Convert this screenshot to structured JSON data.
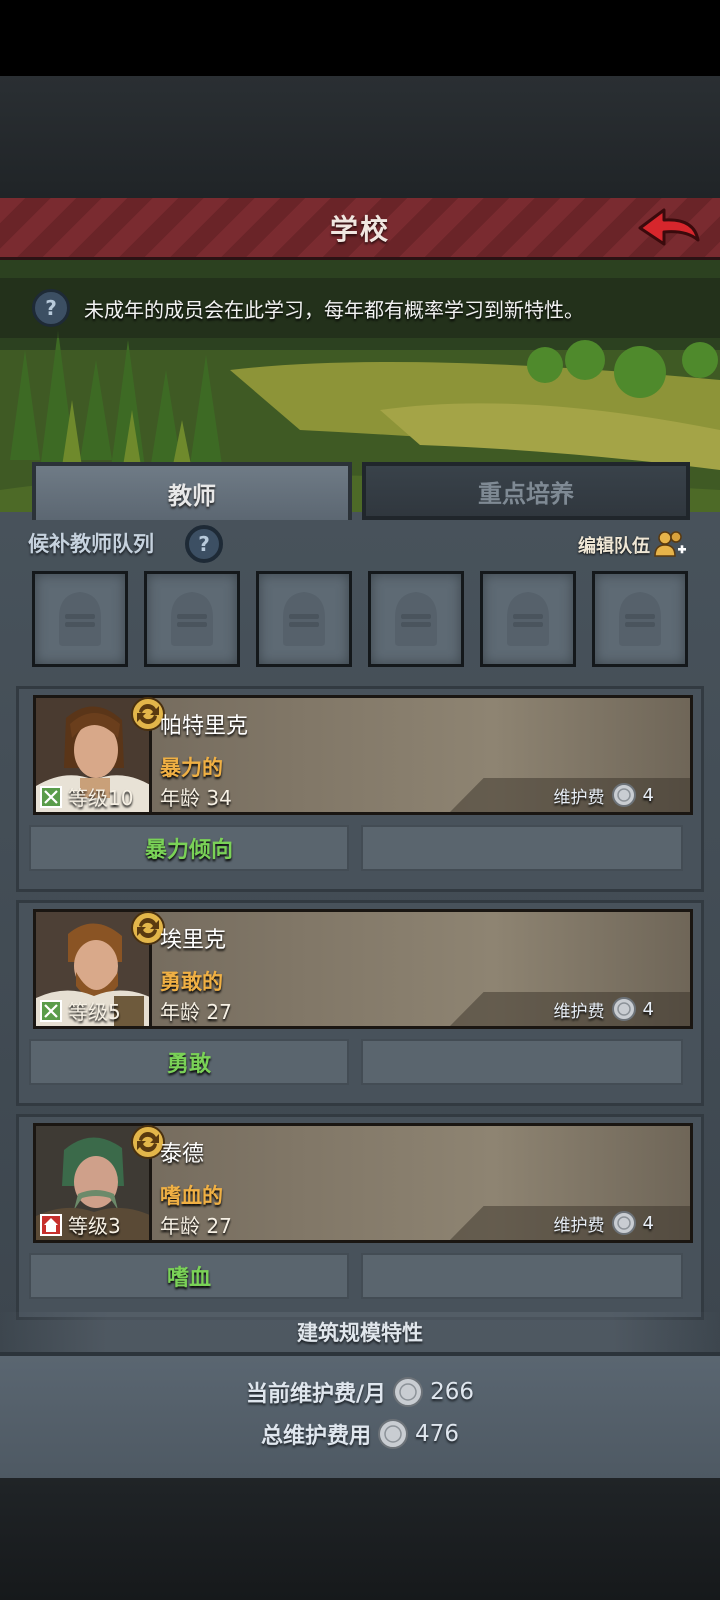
{
  "title": "学校",
  "info_text": "未成年的成员会在此学习，每年都有概率学习到新特性。",
  "help_symbol": "?",
  "tabs": [
    {
      "label": "教师",
      "active": true
    },
    {
      "label": "重点培养",
      "active": false
    }
  ],
  "queue": {
    "label": "候补教师队列",
    "edit_label": "编辑队伍",
    "slot_count": 6
  },
  "teachers": [
    {
      "name": "帕特里克",
      "trait_adj": "暴力的",
      "level_label": "等级10",
      "age_label": "年龄 34",
      "upkeep_label": "维护费",
      "upkeep_value": "4",
      "trait": "暴力倾向",
      "icon": "crossed-swords-icon"
    },
    {
      "name": "埃里克",
      "trait_adj": "勇敢的",
      "level_label": "等级5",
      "age_label": "年龄 27",
      "upkeep_label": "维护费",
      "upkeep_value": "4",
      "trait": "勇敢",
      "icon": "crossed-swords-icon"
    },
    {
      "name": "泰德",
      "trait_adj": "嗜血的",
      "level_label": "等级3",
      "age_label": "年龄 27",
      "upkeep_label": "维护费",
      "upkeep_value": "4",
      "trait": "嗜血",
      "icon": "house-icon"
    }
  ],
  "building_label": "建筑规模特性",
  "costs": {
    "monthly_label": "当前维护费/月",
    "monthly_value": "266",
    "total_label": "总维护费用",
    "total_value": "476"
  },
  "colors": {
    "title_red": "#7a2b30",
    "trait_green": "#7ad257",
    "trait_orange": "#f0b044"
  }
}
